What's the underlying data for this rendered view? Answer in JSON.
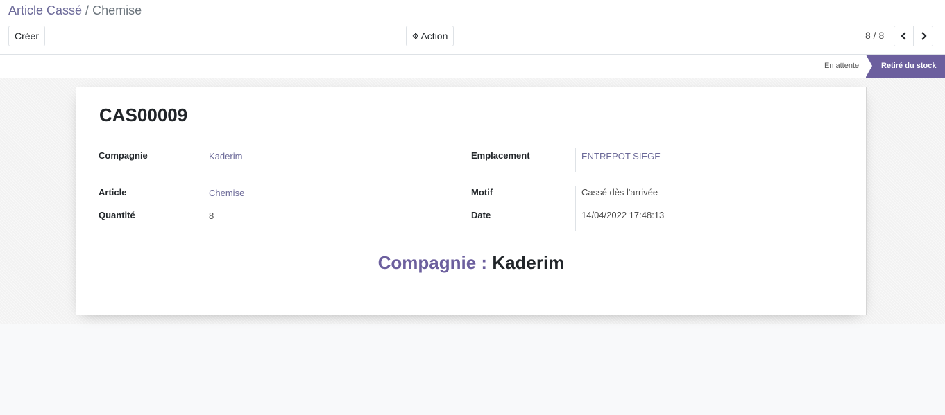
{
  "breadcrumb": {
    "parent": "Article Cassé",
    "separator": "/",
    "current": "Chemise"
  },
  "toolbar": {
    "create_label": "Créer",
    "action_label": "Action",
    "action_icon": "gear-icon"
  },
  "pager": {
    "value": "8 / 8"
  },
  "statusbar": {
    "stages": [
      "En attente",
      "Retiré du stock"
    ],
    "active": "Retiré du stock",
    "active_color": "#6c5f9e"
  },
  "record": {
    "reference": "CAS00009",
    "fields": {
      "company": {
        "label": "Compagnie",
        "value": "Kaderim"
      },
      "article": {
        "label": "Article",
        "value": "Chemise"
      },
      "quantity": {
        "label": "Quantité",
        "value": "8"
      },
      "location": {
        "label": "Emplacement",
        "value": "ENTREPOT SIEGE"
      },
      "reason": {
        "label": "Motif",
        "value": "Cassé dès l'arrivée"
      },
      "date": {
        "label": "Date",
        "value": "14/04/2022 17:48:13"
      }
    },
    "banner": {
      "label": "Compagnie :",
      "value": "Kaderim"
    }
  }
}
